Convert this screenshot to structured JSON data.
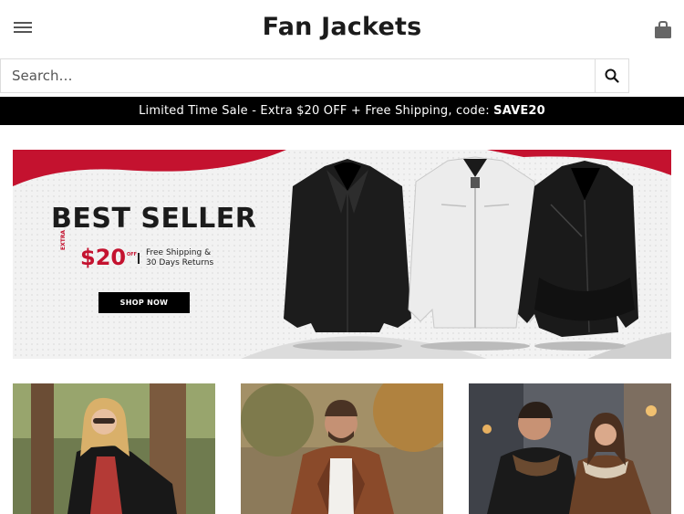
{
  "header": {
    "logo_text": "Fan Jackets",
    "menu_icon": "hamburger-menu-icon",
    "cart_icon": "shopping-bag-icon"
  },
  "search": {
    "placeholder": "Search…",
    "button_icon": "search-icon"
  },
  "promo_bar": {
    "text": "Limited Time Sale - Extra $20 OFF + Free Shipping, code: ",
    "code": "SAVE20"
  },
  "banner": {
    "title": "BEST SELLER",
    "extra_label": "EXTRA",
    "price": "$20",
    "off_label": "OFF",
    "perk_line1": "Free Shipping &",
    "perk_line2": "30 Days Returns",
    "cta_label": "SHOP NOW"
  },
  "tiles": [
    {
      "subject": "woman-black-leather-jacket"
    },
    {
      "subject": "man-brown-leather-jacket"
    },
    {
      "subject": "couple-shearling-jackets"
    }
  ],
  "colors": {
    "accent_red": "#c4122f",
    "promo_bg": "#000000",
    "text_dark": "#1b1b1b"
  }
}
